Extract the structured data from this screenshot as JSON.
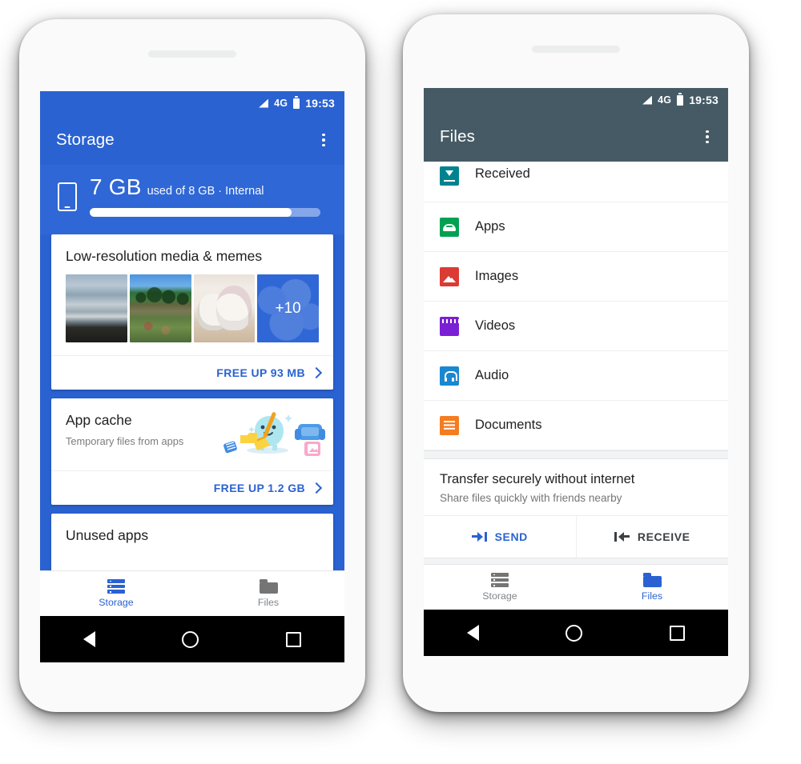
{
  "statusbar": {
    "network": "4G",
    "time": "19:53",
    "signal_icon": "signal-triangle-icon",
    "battery_icon": "battery-full-icon"
  },
  "storage_phone": {
    "appbar": {
      "title": "Storage",
      "overflow_icon": "kebab-menu-icon"
    },
    "accent_color": "#2a62d1",
    "summary": {
      "device_icon": "phone-icon",
      "used": "7 GB",
      "detail": "used of 8 GB · Internal",
      "used_gb": 7,
      "total_gb": 8,
      "percent": 87.5
    },
    "cards": [
      {
        "title": "Low-resolution media & memes",
        "thumbnails": [
          "beach-thumbnail",
          "park-crowd-thumbnail",
          "cats-thumbnail"
        ],
        "overflow_count": "+10",
        "action_label": "FREE UP 93 MB",
        "action_chevron": "chevron-right-icon"
      },
      {
        "title": "App cache",
        "subtitle": "Temporary files from apps",
        "illustration": "cleanup-mascot-illustration",
        "action_label": "FREE UP 1.2 GB",
        "action_chevron": "chevron-right-icon"
      },
      {
        "title": "Unused apps"
      }
    ],
    "tabs": [
      {
        "label": "Storage",
        "icon": "storage-icon",
        "active": true
      },
      {
        "label": "Files",
        "icon": "folder-icon",
        "active": false
      }
    ]
  },
  "files_phone": {
    "appbar": {
      "title": "Files",
      "overflow_icon": "kebab-menu-icon"
    },
    "appbar_color": "#455a64",
    "list": [
      {
        "label": "Received",
        "icon": "received-icon",
        "color": "#00838f"
      },
      {
        "label": "Apps",
        "icon": "android-apps-icon",
        "color": "#00a152"
      },
      {
        "label": "Images",
        "icon": "images-icon",
        "color": "#db3b32"
      },
      {
        "label": "Videos",
        "icon": "videos-icon",
        "color": "#7b1fd6"
      },
      {
        "label": "Audio",
        "icon": "audio-icon",
        "color": "#1a87d1"
      },
      {
        "label": "Documents",
        "icon": "documents-icon",
        "color": "#f57c1f"
      }
    ],
    "promo": {
      "title": "Transfer securely without internet",
      "subtitle": "Share files quickly with friends nearby",
      "send_label": "SEND",
      "send_icon": "send-arrow-icon",
      "receive_label": "RECEIVE",
      "receive_icon": "receive-arrow-icon"
    },
    "tabs": [
      {
        "label": "Storage",
        "icon": "storage-icon",
        "active": false
      },
      {
        "label": "Files",
        "icon": "folder-icon",
        "active": true
      }
    ]
  },
  "navbar": {
    "back_icon": "back-triangle-icon",
    "home_icon": "home-circle-icon",
    "recents_icon": "recents-square-icon"
  }
}
